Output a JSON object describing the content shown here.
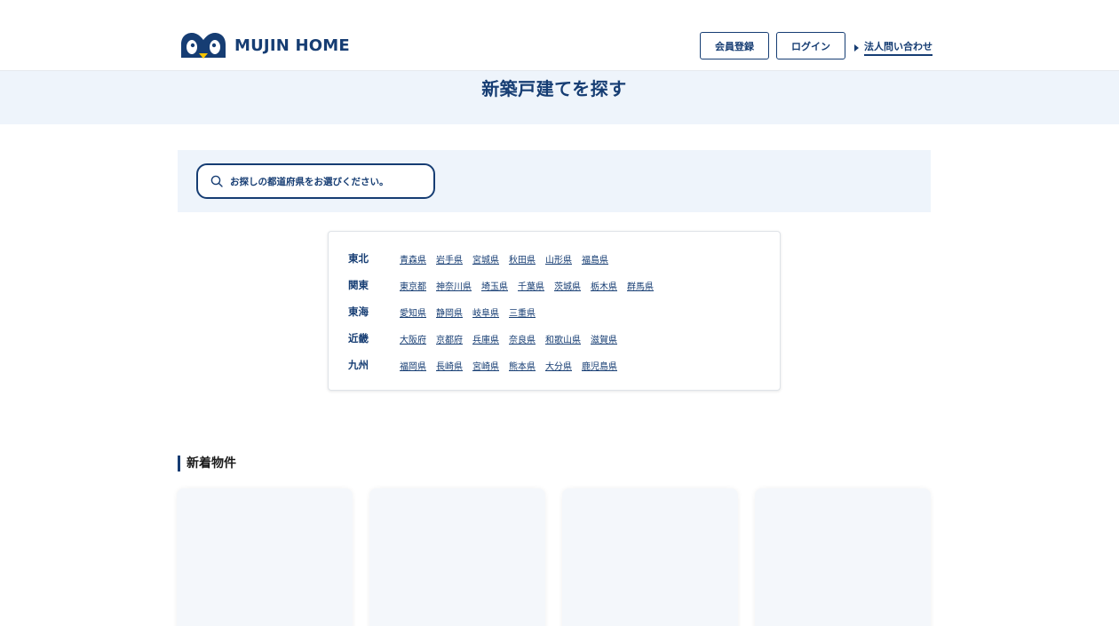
{
  "header": {
    "logo_text": "MUJIN HOME",
    "register_label": "会員登録",
    "login_label": "ログイン",
    "corporate_contact_label": "法人問い合わせ"
  },
  "page_title": "新築戸建てを探す",
  "search": {
    "placeholder": "お探しの都道府県をお選びください。"
  },
  "regions": [
    {
      "name": "東北",
      "prefectures": [
        "青森県",
        "岩手県",
        "宮城県",
        "秋田県",
        "山形県",
        "福島県"
      ]
    },
    {
      "name": "関東",
      "prefectures": [
        "東京都",
        "神奈川県",
        "埼玉県",
        "千葉県",
        "茨城県",
        "栃木県",
        "群馬県"
      ]
    },
    {
      "name": "東海",
      "prefectures": [
        "愛知県",
        "静岡県",
        "岐阜県",
        "三重県"
      ]
    },
    {
      "name": "近畿",
      "prefectures": [
        "大阪府",
        "京都府",
        "兵庫県",
        "奈良県",
        "和歌山県",
        "滋賀県"
      ]
    },
    {
      "name": "九州",
      "prefectures": [
        "福岡県",
        "長崎県",
        "宮崎県",
        "熊本県",
        "大分県",
        "鹿児島県"
      ]
    }
  ],
  "new_listings": {
    "title": "新着物件",
    "card_count": 4
  },
  "colors": {
    "brand_navy": "#163d73",
    "band_bg": "#eef4fb",
    "logo_accent": "#f5c400"
  }
}
